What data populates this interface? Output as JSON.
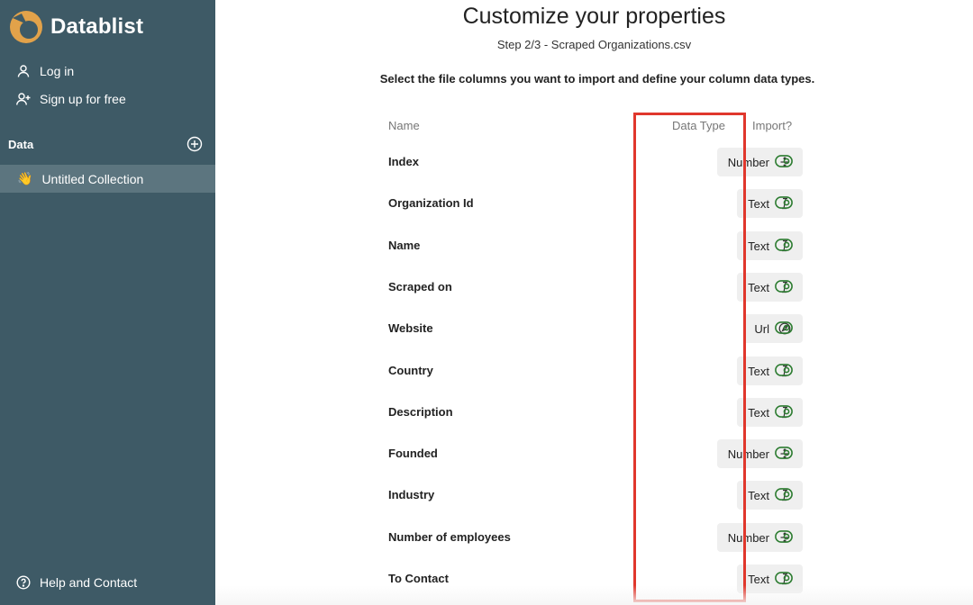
{
  "app": {
    "name": "Datablist",
    "brand_color": "#e2a24a",
    "sidebar_bg": "#3e5a66"
  },
  "sidebar": {
    "login_label": "Log in",
    "signup_label": "Sign up for free",
    "section_label": "Data",
    "collection_emoji": "👋",
    "collection_label": "Untitled Collection",
    "help_label": "Help and Contact"
  },
  "page": {
    "title": "Customize your properties",
    "subtitle": "Step 2/3 - Scraped Organizations.csv",
    "instructions": "Select the file columns you want to import and define your column data types."
  },
  "table": {
    "headers": {
      "name": "Name",
      "type": "Data Type",
      "import": "Import?"
    },
    "rows": [
      {
        "name": "Index",
        "type": "Number",
        "icon": "divide-icon",
        "import": true
      },
      {
        "name": "Organization Id",
        "type": "Text",
        "icon": "text-cursor-icon",
        "import": true
      },
      {
        "name": "Name",
        "type": "Text",
        "icon": "text-cursor-icon",
        "import": true
      },
      {
        "name": "Scraped on",
        "type": "Text",
        "icon": "text-cursor-icon",
        "import": true
      },
      {
        "name": "Website",
        "type": "Url",
        "icon": "compass-icon",
        "import": true
      },
      {
        "name": "Country",
        "type": "Text",
        "icon": "text-cursor-icon",
        "import": true
      },
      {
        "name": "Description",
        "type": "Text",
        "icon": "text-cursor-icon",
        "import": true
      },
      {
        "name": "Founded",
        "type": "Number",
        "icon": "divide-icon",
        "import": true
      },
      {
        "name": "Industry",
        "type": "Text",
        "icon": "text-cursor-icon",
        "import": true
      },
      {
        "name": "Number of employees",
        "type": "Number",
        "icon": "divide-icon",
        "import": true
      },
      {
        "name": "To Contact",
        "type": "Text",
        "icon": "text-cursor-icon",
        "import": true
      }
    ],
    "toggle_on_color": "#2e7d32",
    "highlight_color": "#e0372c"
  }
}
